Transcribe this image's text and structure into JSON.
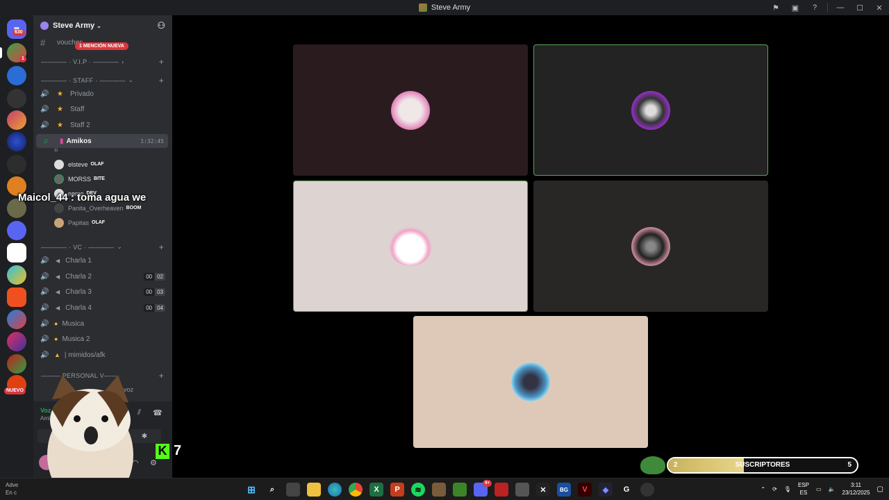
{
  "window": {
    "title": "Steve Army"
  },
  "guilds": {
    "home_badge": "630",
    "first_badge": "1",
    "new_label": "NUEVO"
  },
  "server": {
    "name": "Steve Army"
  },
  "channels": {
    "text_channel": "vouches",
    "mention_badge": "1 MENCIÓN NUEVA",
    "cat_vip": "———— · V.I.P · ————",
    "cat_staff": "———— · STAFF · ————",
    "cat_vc": "———— · VC · ————",
    "cat_personal": "——— PERSONAL V——",
    "voice": [
      {
        "name": "Privado"
      },
      {
        "name": "Staff"
      },
      {
        "name": "Staff 2"
      },
      {
        "name": "Amikos",
        "time": "1:32:45",
        "status": "si"
      },
      {
        "name": "Charla 1"
      },
      {
        "name": "Charla 2",
        "count_a": "00",
        "count_b": "02"
      },
      {
        "name": "Charla 3",
        "count_a": "00",
        "count_b": "03"
      },
      {
        "name": "Charla 4",
        "count_a": "00",
        "count_b": "04"
      },
      {
        "name": "Musica"
      },
      {
        "name": "Musica 2"
      },
      {
        "name": "| mimidos/afk"
      }
    ],
    "personal_suffix": "voz"
  },
  "members": [
    {
      "name": "elsteve",
      "tag": "OLAF"
    },
    {
      "name": "MORSS",
      "tag": "BITE"
    },
    {
      "name": "nemo",
      "tag": "DEV"
    },
    {
      "name": "Panita_Overheaven",
      "tag": "BOOM"
    },
    {
      "name": "Papitas",
      "tag": "OLAF"
    }
  ],
  "voice_panel": {
    "status": "Voz co",
    "sub": "Ami"
  },
  "user": {
    "name": "elsteve"
  },
  "overlay": {
    "message": "Maicol_44 : toma agua we",
    "kick_count": "7"
  },
  "subs": {
    "current": "2",
    "label": "SUSCRIPTORES",
    "goal": "5",
    "progress": 0.4
  },
  "taskbar": {
    "weather_1": "Adve",
    "weather_2": "En c",
    "lang_1": "ESP",
    "lang_2": "ES",
    "time": "3:11",
    "date": "23/12/2025",
    "discord_badge": "9+"
  },
  "colors": {
    "speaking": "#5aa657",
    "accent": "#5865f2",
    "danger": "#da373c"
  }
}
